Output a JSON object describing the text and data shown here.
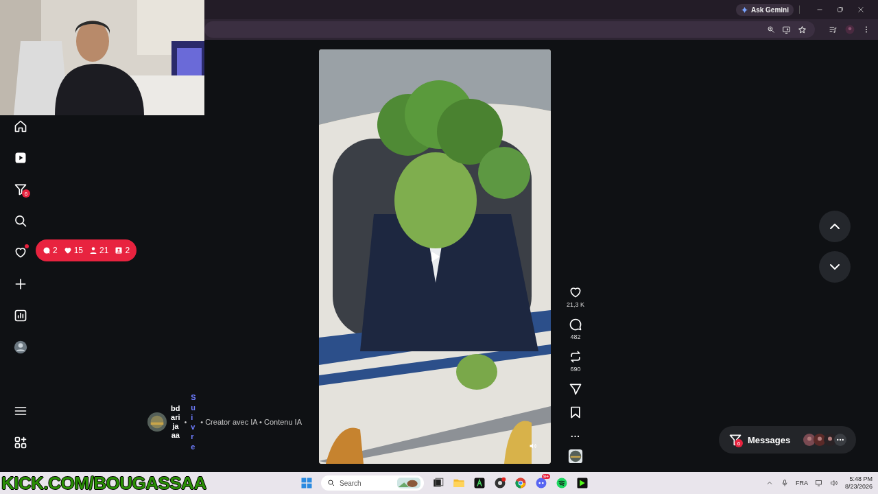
{
  "browser": {
    "ask_gemini": "Ask Gemini"
  },
  "sidebar": {
    "items": [
      {
        "kind": "home"
      },
      {
        "kind": "reels"
      },
      {
        "kind": "messages",
        "badge": "6"
      },
      {
        "kind": "search"
      },
      {
        "kind": "notifications",
        "dot": true
      },
      {
        "kind": "create"
      },
      {
        "kind": "dashboard"
      },
      {
        "kind": "profile"
      }
    ],
    "bottom_items": [
      {
        "kind": "menu"
      },
      {
        "kind": "more"
      }
    ]
  },
  "notification_pill": [
    {
      "kind": "comment",
      "count": "2"
    },
    {
      "kind": "like",
      "count": "15"
    },
    {
      "kind": "follower",
      "count": "21"
    },
    {
      "kind": "request",
      "count": "2"
    }
  ],
  "post": {
    "author": "bdarijaaa",
    "separator": "•",
    "follow": "Suivre",
    "description": "• Creator avec IA • Contenu IA",
    "paused": true,
    "muted": false
  },
  "actions": [
    {
      "kind": "like",
      "count": "21,3 K"
    },
    {
      "kind": "comment",
      "count": "482"
    },
    {
      "kind": "repost",
      "count": "690"
    },
    {
      "kind": "share"
    },
    {
      "kind": "save"
    },
    {
      "kind": "more",
      "label": "..."
    },
    {
      "kind": "audio"
    }
  ],
  "messages": {
    "label": "Messages",
    "badge": "6"
  },
  "overlay": {
    "banner": "KICK.COM/BOUGASSAA"
  },
  "taskbar": {
    "search_placeholder": "Search",
    "apps": [
      {
        "kind": "taskview"
      },
      {
        "kind": "folder"
      },
      {
        "kind": "green"
      },
      {
        "kind": "record"
      },
      {
        "kind": "browser"
      },
      {
        "kind": "chat",
        "badge": "9+"
      },
      {
        "kind": "music"
      },
      {
        "kind": "stream"
      }
    ],
    "language": "FRA",
    "time": "5:48 PM",
    "date": "8/23/2026"
  }
}
